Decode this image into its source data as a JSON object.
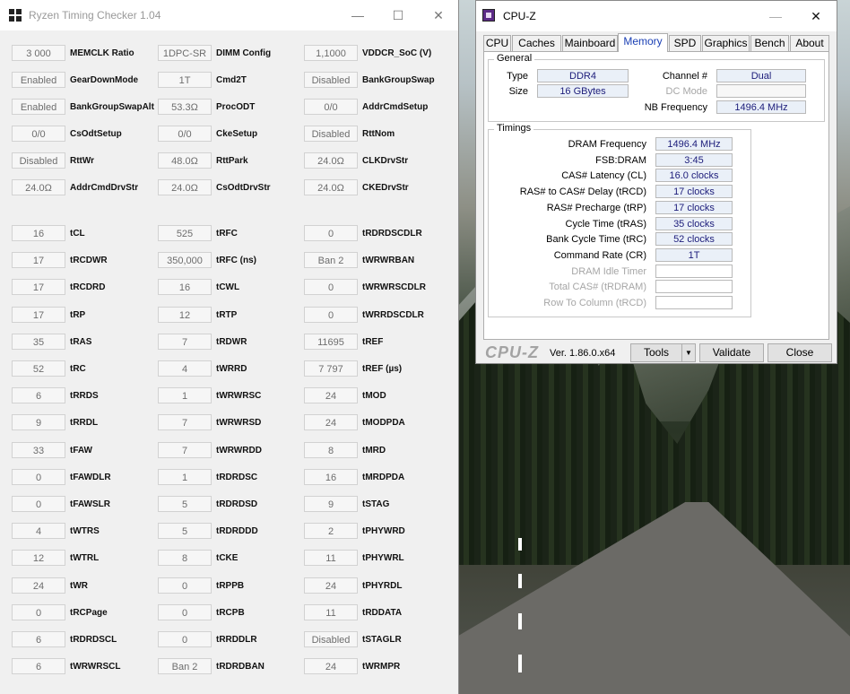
{
  "ryzen_window": {
    "title": "Ryzen Timing Checker 1.04",
    "minimize_glyph": "—",
    "maximize_glyph": "☐",
    "close_glyph": "✕",
    "rows": [
      [
        "3 000",
        "MEMCLK Ratio",
        "1DPC-SR",
        "DIMM Config",
        "1,1000",
        "VDDCR_SoC (V)"
      ],
      [
        "Enabled",
        "GearDownMode",
        "1T",
        "Cmd2T",
        "Disabled",
        "BankGroupSwap"
      ],
      [
        "Enabled",
        "BankGroupSwapAlt",
        "53.3Ω",
        "ProcODT",
        "0/0",
        "AddrCmdSetup"
      ],
      [
        "0/0",
        "CsOdtSetup",
        "0/0",
        "CkeSetup",
        "Disabled",
        "RttNom"
      ],
      [
        "Disabled",
        "RttWr",
        "48.0Ω",
        "RttPark",
        "24.0Ω",
        "CLKDrvStr"
      ],
      [
        "24.0Ω",
        "AddrCmdDrvStr",
        "24.0Ω",
        "CsOdtDrvStr",
        "24.0Ω",
        "CKEDrvStr"
      ],
      [
        "16",
        "tCL",
        "525",
        "tRFC",
        "0",
        "tRDRDSCDLR"
      ],
      [
        "17",
        "tRCDWR",
        "350,000",
        "tRFC (ns)",
        "Ban 2",
        "tWRWRBAN"
      ],
      [
        "17",
        "tRCDRD",
        "16",
        "tCWL",
        "0",
        "tWRWRSCDLR"
      ],
      [
        "17",
        "tRP",
        "12",
        "tRTP",
        "0",
        "tWRRDSCDLR"
      ],
      [
        "35",
        "tRAS",
        "7",
        "tRDWR",
        "11695",
        "tREF"
      ],
      [
        "52",
        "tRC",
        "4",
        "tWRRD",
        "7 797",
        "tREF (µs)"
      ],
      [
        "6",
        "tRRDS",
        "1",
        "tWRWRSC",
        "24",
        "tMOD"
      ],
      [
        "9",
        "tRRDL",
        "7",
        "tWRWRSD",
        "24",
        "tMODPDA"
      ],
      [
        "33",
        "tFAW",
        "7",
        "tWRWRDD",
        "8",
        "tMRD"
      ],
      [
        "0",
        "tFAWDLR",
        "1",
        "tRDRDSC",
        "16",
        "tMRDPDA"
      ],
      [
        "0",
        "tFAWSLR",
        "5",
        "tRDRDSD",
        "9",
        "tSTAG"
      ],
      [
        "4",
        "tWTRS",
        "5",
        "tRDRDDD",
        "2",
        "tPHYWRD"
      ],
      [
        "12",
        "tWTRL",
        "8",
        "tCKE",
        "11",
        "tPHYWRL"
      ],
      [
        "24",
        "tWR",
        "0",
        "tRPPB",
        "24",
        "tPHYRDL"
      ],
      [
        "0",
        "tRCPage",
        "0",
        "tRCPB",
        "11",
        "tRDDATA"
      ],
      [
        "6",
        "tRDRDSCL",
        "0",
        "tRRDDLR",
        "Disabled",
        "tSTAGLR"
      ],
      [
        "6",
        "tWRWRSCL",
        "Ban 2",
        "tRDRDBAN",
        "24",
        "tWRMPR"
      ]
    ]
  },
  "cpuz_window": {
    "title": "CPU-Z",
    "minimize_glyph": "—",
    "maximize_glyph": "☐",
    "close_glyph": "✕",
    "tabs": [
      "CPU",
      "Caches",
      "Mainboard",
      "Memory",
      "SPD",
      "Graphics",
      "Bench",
      "About"
    ],
    "active_tab": "Memory",
    "general": {
      "title": "General",
      "type_label": "Type",
      "type_value": "DDR4",
      "size_label": "Size",
      "size_value": "16 GBytes",
      "channel_label": "Channel #",
      "channel_value": "Dual",
      "dcmode_label": "DC Mode",
      "dcmode_value": "",
      "nbfreq_label": "NB Frequency",
      "nbfreq_value": "1496.4 MHz"
    },
    "timings": {
      "title": "Timings",
      "rows": [
        {
          "label": "DRAM Frequency",
          "value": "1496.4 MHz",
          "dim": false
        },
        {
          "label": "FSB:DRAM",
          "value": "3:45",
          "dim": false
        },
        {
          "label": "CAS# Latency (CL)",
          "value": "16.0 clocks",
          "dim": false
        },
        {
          "label": "RAS# to CAS# Delay (tRCD)",
          "value": "17 clocks",
          "dim": false
        },
        {
          "label": "RAS# Precharge (tRP)",
          "value": "17 clocks",
          "dim": false
        },
        {
          "label": "Cycle Time (tRAS)",
          "value": "35 clocks",
          "dim": false
        },
        {
          "label": "Bank Cycle Time (tRC)",
          "value": "52 clocks",
          "dim": false
        },
        {
          "label": "Command Rate (CR)",
          "value": "1T",
          "dim": false
        },
        {
          "label": "DRAM Idle Timer",
          "value": "",
          "dim": true
        },
        {
          "label": "Total CAS# (tRDRAM)",
          "value": "",
          "dim": true
        },
        {
          "label": "Row To Column (tRCD)",
          "value": "",
          "dim": true
        }
      ]
    },
    "brand": "CPU-Z",
    "version": "Ver. 1.86.0.x64",
    "tools_label": "Tools",
    "tools_arrow": "▼",
    "validate_label": "Validate",
    "close_label": "Close"
  }
}
